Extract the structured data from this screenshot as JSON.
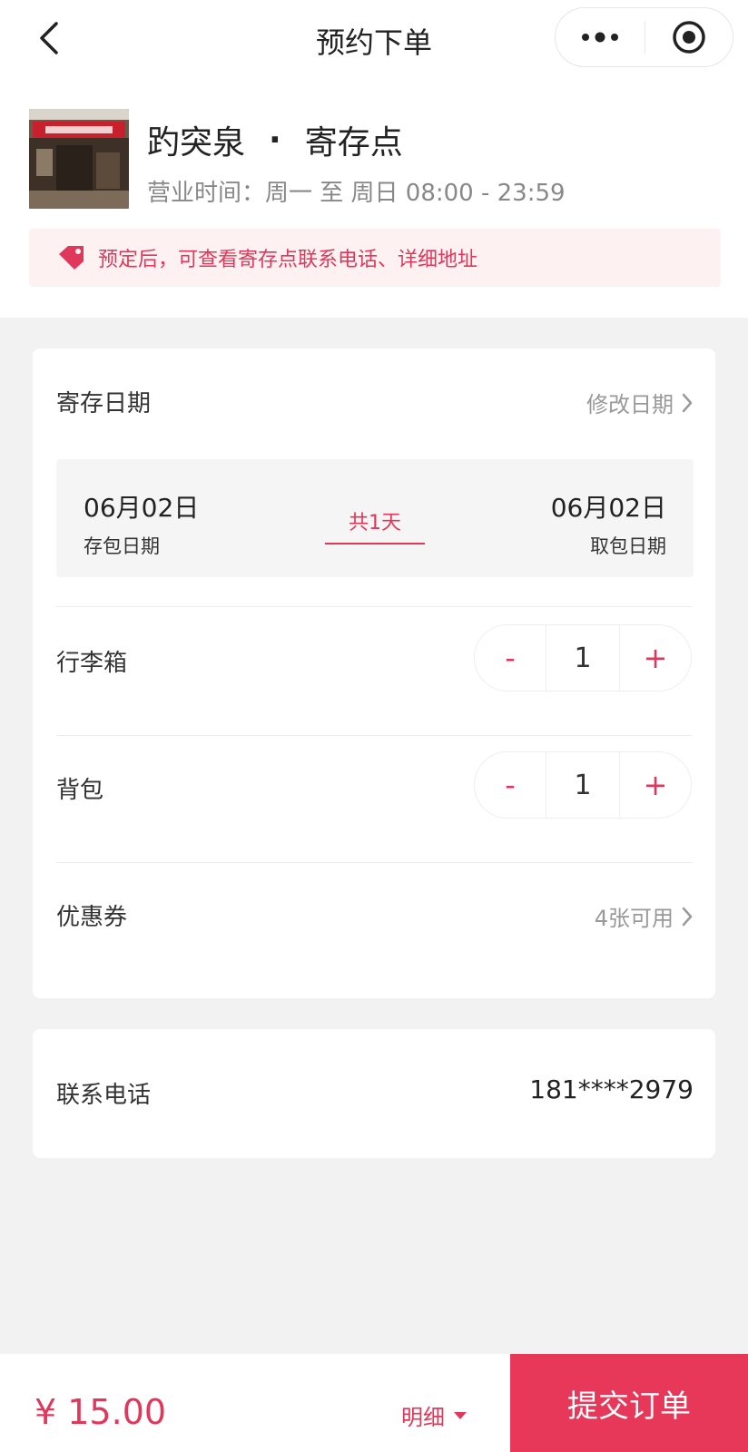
{
  "nav": {
    "title": "预约下单"
  },
  "store": {
    "name": "趵突泉",
    "type": "寄存点",
    "hours": "营业时间：周一 至 周日 08:00 - 23:59",
    "notice": "预定后，可查看寄存点联系电话、详细地址"
  },
  "storage": {
    "label": "寄存日期",
    "change_label": "修改日期",
    "start_date": "06月02日",
    "start_caption": "存包日期",
    "duration": "共1天",
    "end_date": "06月02日",
    "end_caption": "取包日期"
  },
  "suitcase": {
    "label": "行李箱",
    "minus": "-",
    "qty": "1",
    "plus": "+"
  },
  "backpack": {
    "label": "背包",
    "minus": "-",
    "qty": "1",
    "plus": "+"
  },
  "coupon": {
    "label": "优惠券",
    "available": "4张可用"
  },
  "contact": {
    "label": "联系电话",
    "phone": "181****2979"
  },
  "footer": {
    "price": "¥ 15.00",
    "detail_label": "明细",
    "submit_label": "提交订单"
  },
  "colors": {
    "accent": "#e0385a",
    "notice_bg": "#fdf1f2",
    "page_bg": "#f2f2f2"
  }
}
